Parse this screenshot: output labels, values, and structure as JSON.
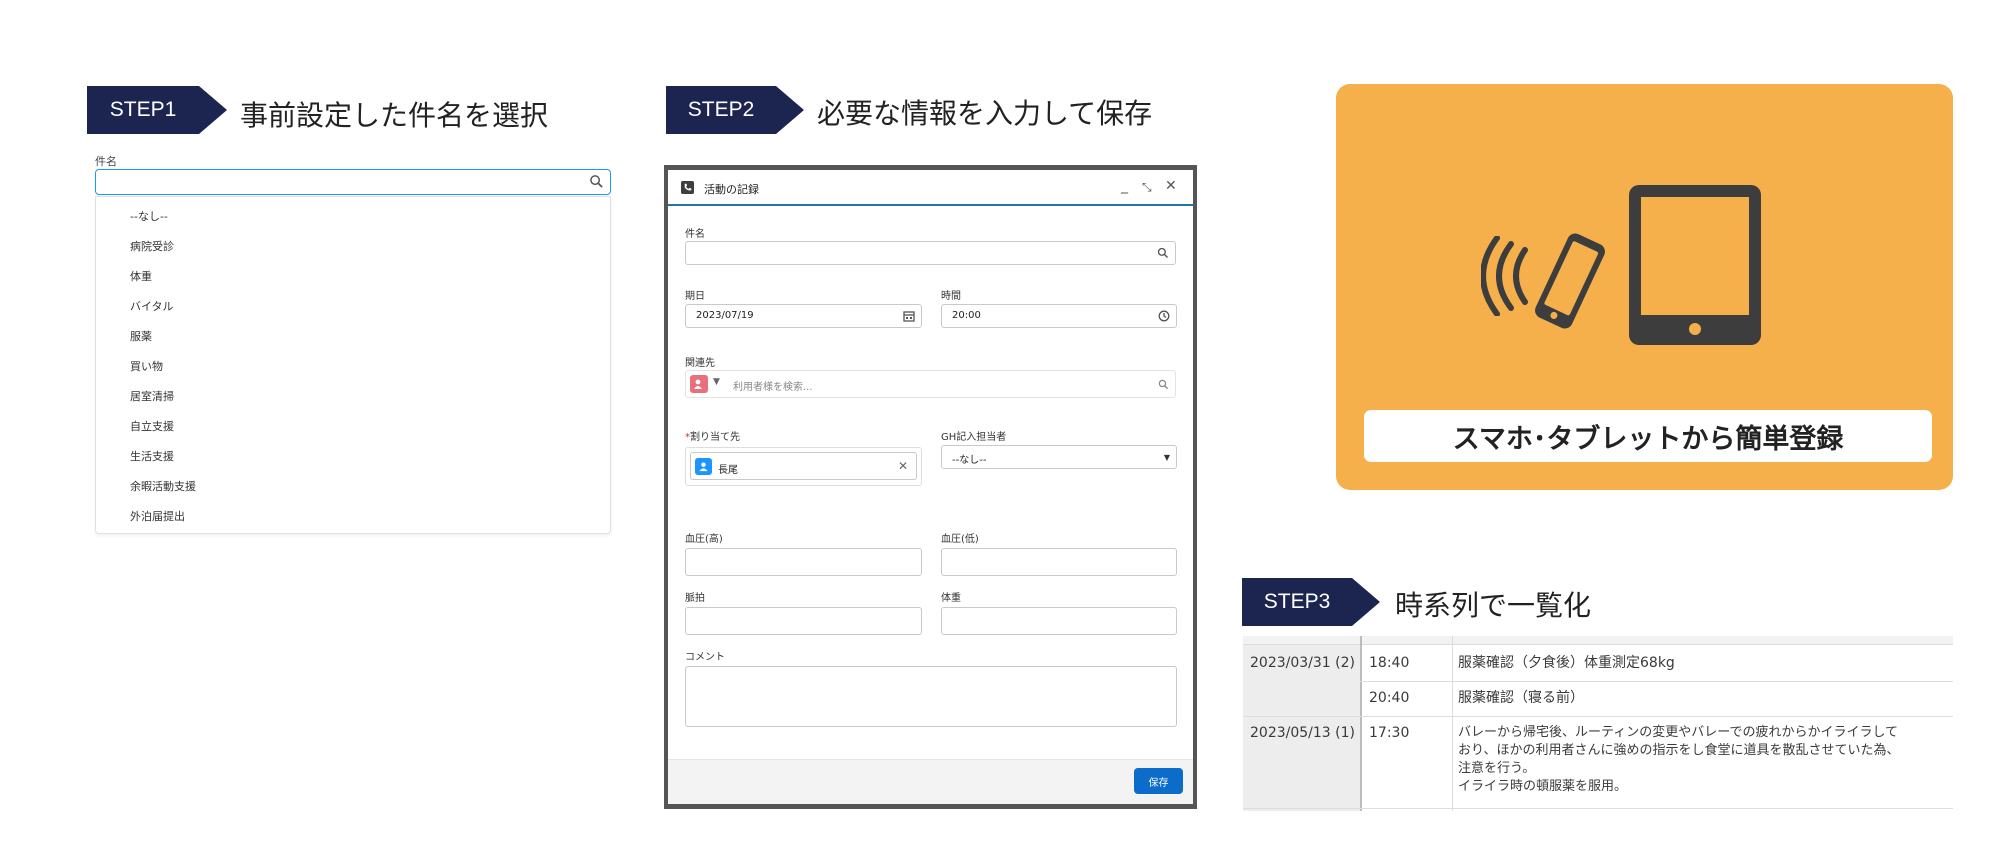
{
  "step1": {
    "badge": "STEP1",
    "title": "事前設定した件名を選択",
    "field_label": "件名",
    "input_value": "",
    "options": [
      "--なし--",
      "病院受診",
      "体重",
      "バイタル",
      "服薬",
      "買い物",
      "居室清掃",
      "自立支援",
      "生活支援",
      "余暇活動支援",
      "外泊届提出"
    ]
  },
  "step2": {
    "badge": "STEP2",
    "title": "必要な情報を入力して保存",
    "dialog": {
      "title": "活動の記録",
      "subject_label": "件名",
      "date_label": "期日",
      "date_value": "2023/07/19",
      "time_label": "時間",
      "time_value": "20:00",
      "related_label": "関連先",
      "related_placeholder": "利用者様を検索...",
      "assignee_label": "割り当て先",
      "assignee_value": "長尾",
      "gh_label": "GH記入担当者",
      "gh_value": "--なし--",
      "bp_high_label": "血圧(高)",
      "bp_low_label": "血圧(低)",
      "pulse_label": "脈拍",
      "weight_label": "体重",
      "comment_label": "コメント",
      "save_label": "保存"
    }
  },
  "promo": {
    "caption": "スマホ･タブレットから簡単登録"
  },
  "step3": {
    "badge": "STEP3",
    "title": "時系列で一覧化",
    "rows": [
      {
        "date": "2023/03/31 (2)",
        "time": "18:40",
        "text": "服薬確認（夕食後）体重測定68kg"
      },
      {
        "date": "",
        "time": "20:40",
        "text": "服薬確認（寝る前）"
      },
      {
        "date": "2023/05/13 (1)",
        "time": "17:30",
        "text_lines": [
          "バレーから帰宅後、ルーティンの変更やバレーでの疲れからかイライラして",
          "おり、ほかの利用者さんに強めの指示をし食堂に道具を散乱させていた為、",
          "注意を行う。",
          "イライラ時の頓服薬を服用。"
        ]
      }
    ]
  },
  "colors": {
    "banner": "#1c2550",
    "promo_bg": "#f5b04c",
    "focus": "#1b96ff",
    "save_button": "#0b6cc9"
  }
}
